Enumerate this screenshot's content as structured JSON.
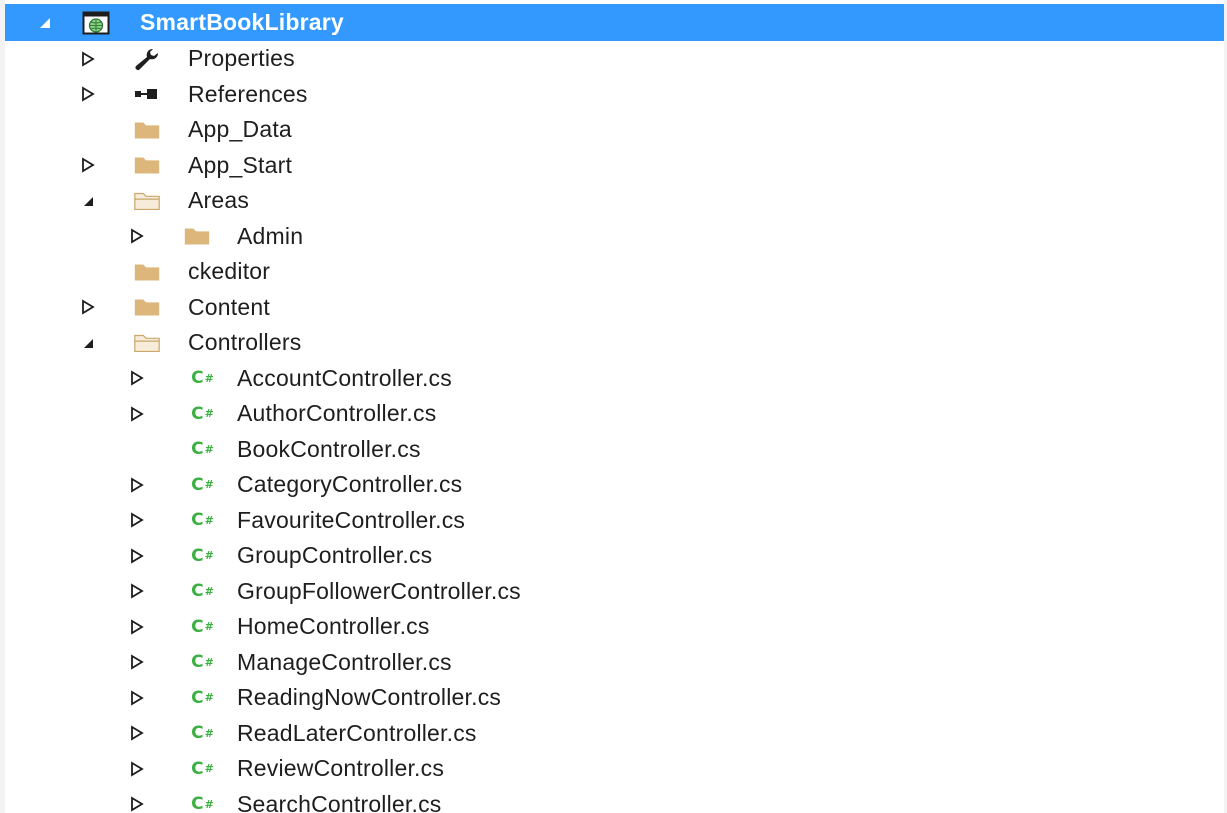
{
  "colors": {
    "selection": "#3399ff",
    "folder": "#dcb67a",
    "folder_open": "#e8d2a8",
    "csharp": "#3cb043",
    "text": "#1e1e1e",
    "arrow": "#1e1e1e"
  },
  "tree": {
    "project": {
      "label": "SmartBookLibrary",
      "icon": "web-project-icon",
      "expanded": true
    },
    "items": [
      {
        "label": "Properties",
        "icon": "wrench-icon",
        "expander": "collapsed"
      },
      {
        "label": "References",
        "icon": "references-icon",
        "expander": "collapsed"
      },
      {
        "label": "App_Data",
        "icon": "folder-icon",
        "expander": "none"
      },
      {
        "label": "App_Start",
        "icon": "folder-icon",
        "expander": "collapsed"
      },
      {
        "label": "Areas",
        "icon": "folder-open-icon",
        "expander": "expanded"
      },
      {
        "label": "Admin",
        "icon": "folder-icon",
        "expander": "collapsed"
      },
      {
        "label": "ckeditor",
        "icon": "folder-icon",
        "expander": "none"
      },
      {
        "label": "Content",
        "icon": "folder-icon",
        "expander": "collapsed"
      },
      {
        "label": "Controllers",
        "icon": "folder-open-icon",
        "expander": "expanded"
      },
      {
        "label": "AccountController.cs",
        "icon": "csharp-file-icon",
        "expander": "collapsed"
      },
      {
        "label": "AuthorController.cs",
        "icon": "csharp-file-icon",
        "expander": "collapsed"
      },
      {
        "label": "BookController.cs",
        "icon": "csharp-file-icon",
        "expander": "none"
      },
      {
        "label": "CategoryController.cs",
        "icon": "csharp-file-icon",
        "expander": "collapsed"
      },
      {
        "label": "FavouriteController.cs",
        "icon": "csharp-file-icon",
        "expander": "collapsed"
      },
      {
        "label": "GroupController.cs",
        "icon": "csharp-file-icon",
        "expander": "collapsed"
      },
      {
        "label": "GroupFollowerController.cs",
        "icon": "csharp-file-icon",
        "expander": "collapsed"
      },
      {
        "label": "HomeController.cs",
        "icon": "csharp-file-icon",
        "expander": "collapsed"
      },
      {
        "label": "ManageController.cs",
        "icon": "csharp-file-icon",
        "expander": "collapsed"
      },
      {
        "label": "ReadingNowController.cs",
        "icon": "csharp-file-icon",
        "expander": "collapsed"
      },
      {
        "label": "ReadLaterController.cs",
        "icon": "csharp-file-icon",
        "expander": "collapsed"
      },
      {
        "label": "ReviewController.cs",
        "icon": "csharp-file-icon",
        "expander": "collapsed"
      },
      {
        "label": "SearchController.cs",
        "icon": "csharp-file-icon",
        "expander": "collapsed"
      }
    ]
  }
}
